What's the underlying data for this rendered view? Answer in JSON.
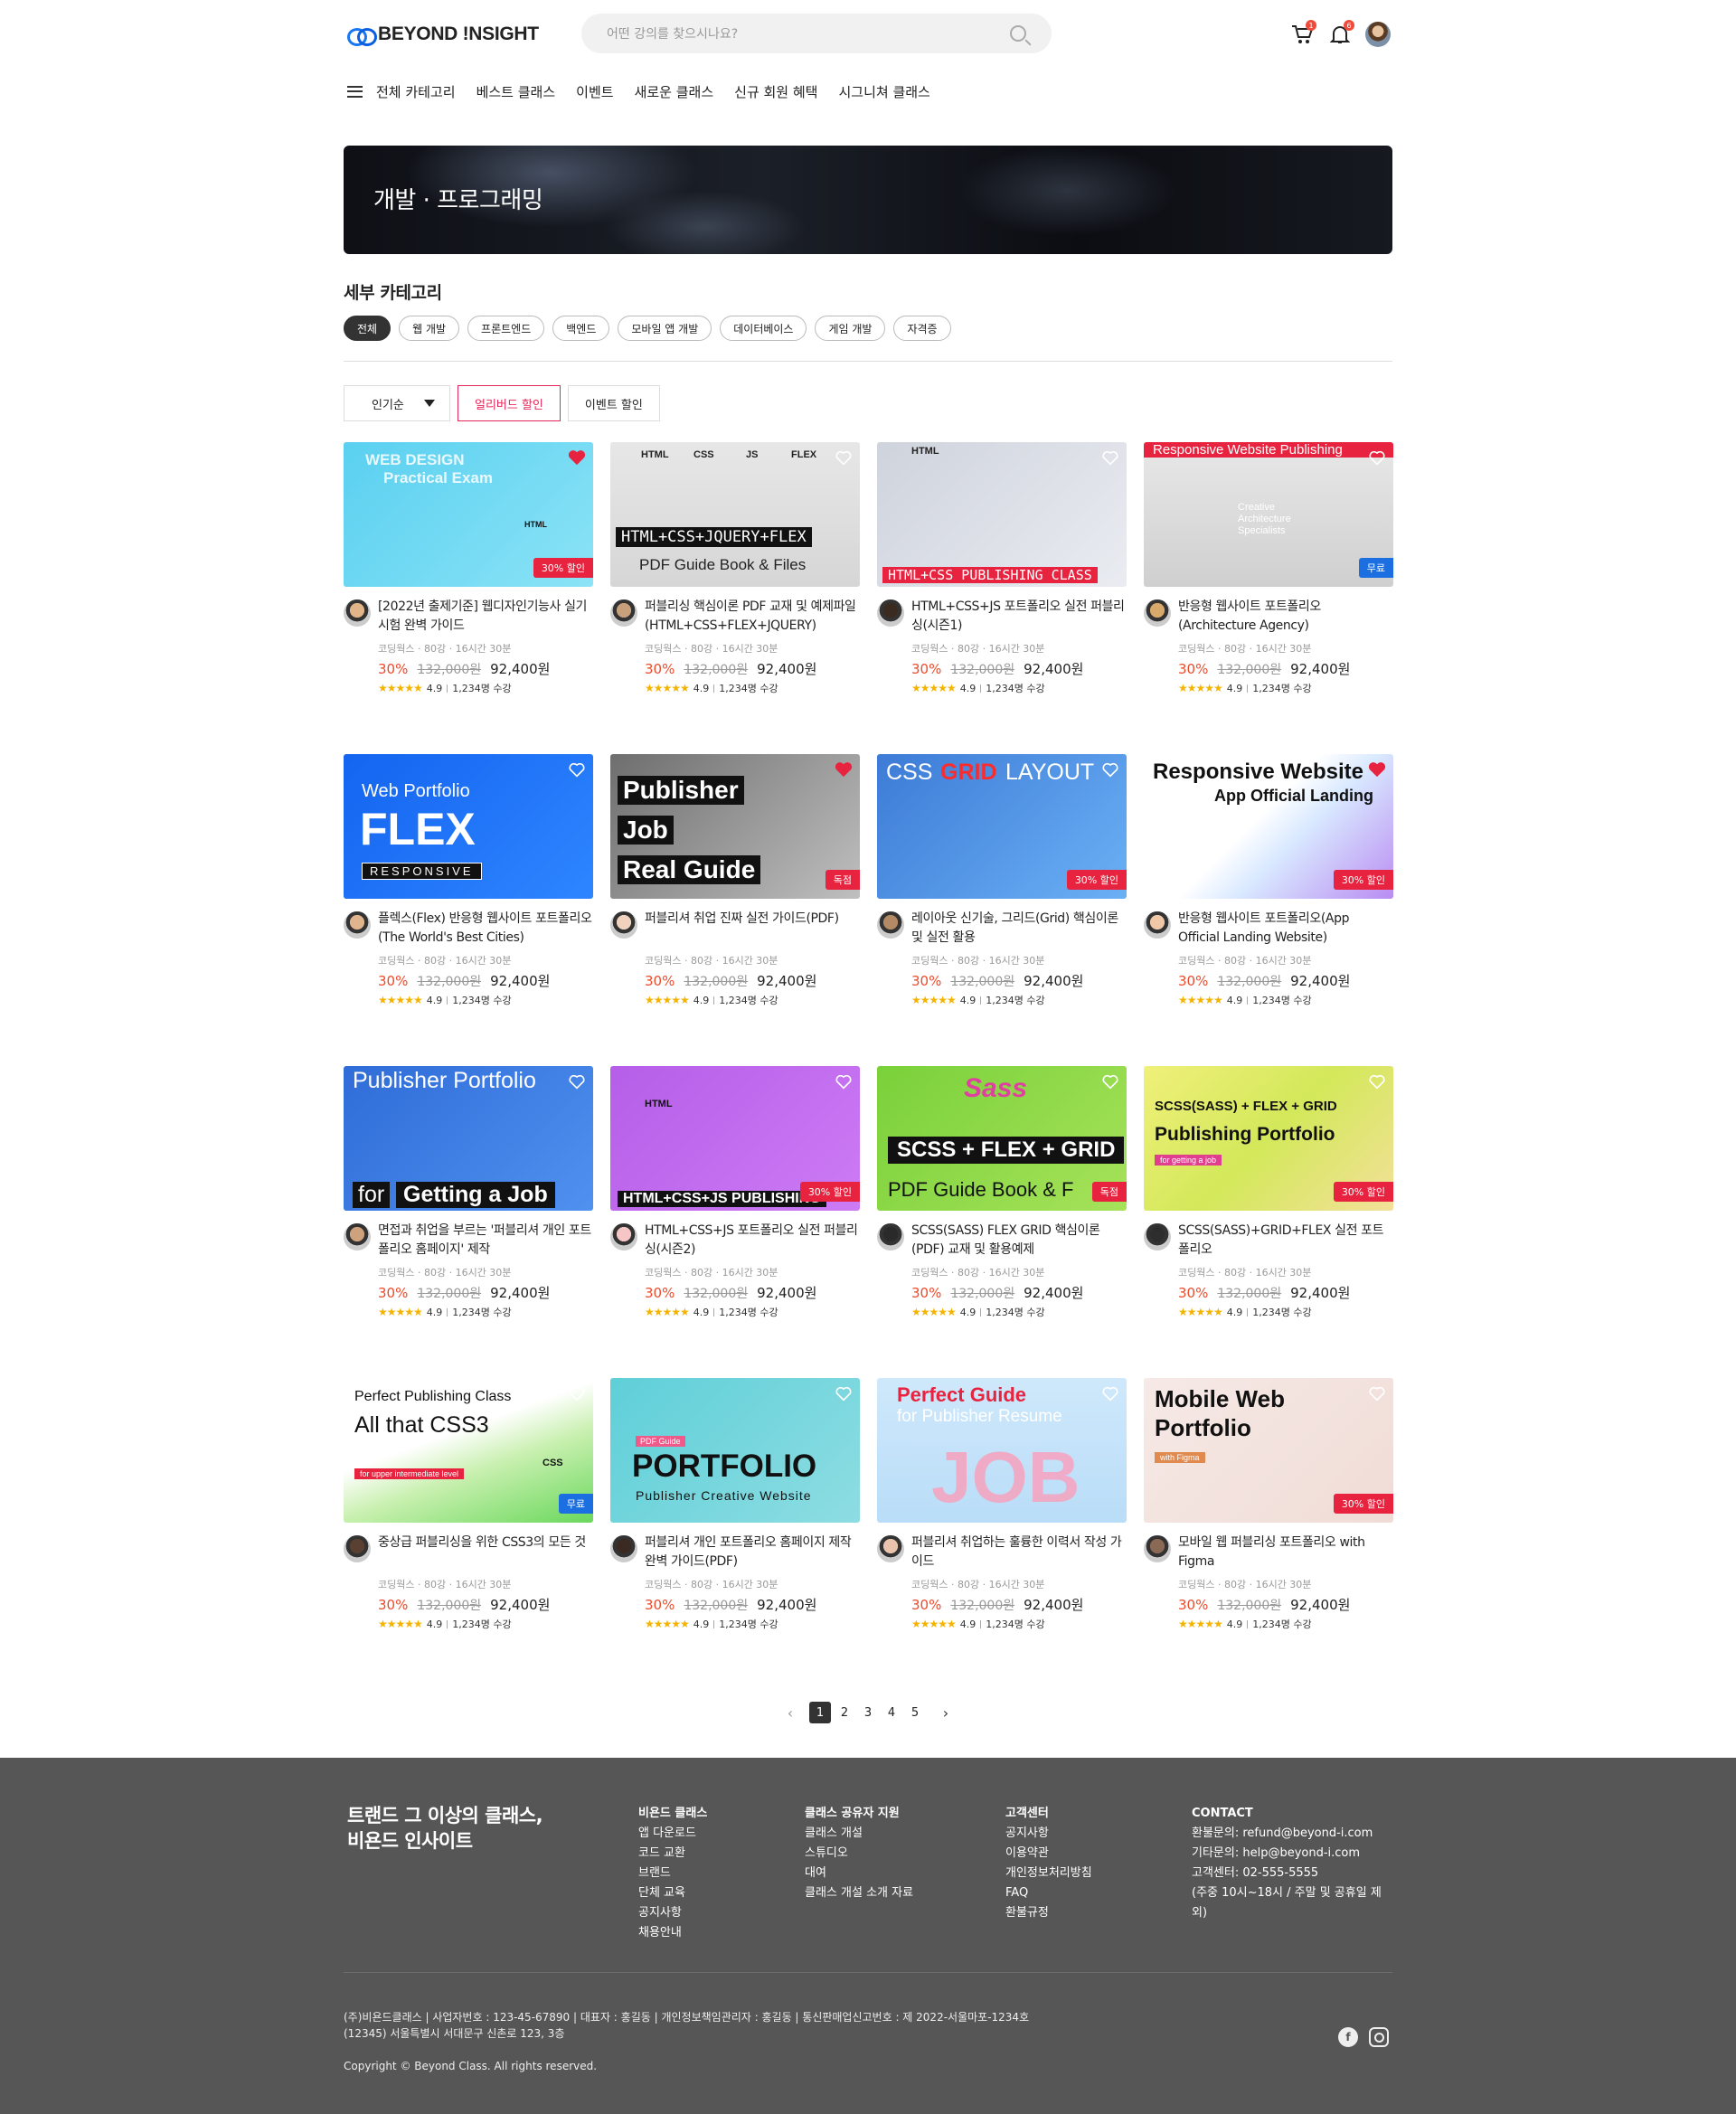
{
  "header": {
    "logo": "BEYOND !NSIGHT",
    "search_placeholder": "어떤 강의를 찾으시나요?",
    "cart_count": "1",
    "notice_count": "6"
  },
  "nav": {
    "items": [
      "전체 카테고리",
      "베스트 클래스",
      "이벤트",
      "새로운 클래스",
      "신규 회원 혜택",
      "시그니쳐 클래스"
    ]
  },
  "banner": {
    "title": "개발 · 프로그래밍"
  },
  "subcategory": {
    "title": "세부 카테고리",
    "chips": [
      "전체",
      "웹 개발",
      "프론트엔드",
      "백엔드",
      "모바일 앱 개발",
      "데이터베이스",
      "게임 개발",
      "자격증"
    ]
  },
  "filters": {
    "sort": "인기순",
    "early": "얼리버드 할인",
    "event": "이벤트 할인"
  },
  "course_common": {
    "teacher": "코딩웍스 · 80강 · 16시간 30분",
    "rate": "30%",
    "orig": "132,000원",
    "sale": "92,400원",
    "stars": "★★★★★",
    "score": "4.9",
    "students": "1,234명 수강"
  },
  "courses": [
    {
      "title": "[2022년 출제기준] 웹디자인기능사 실기시험 완벽 가이드",
      "tag": "30% 할인",
      "liked": true,
      "thumb_text": [
        "WEB DESIGN",
        "Practical Exam",
        "HTML"
      ]
    },
    {
      "title": "퍼블리싱 핵심이론 PDF 교재 및 예제파일(HTML+CSS+FLEX+JQUERY)",
      "tag": "",
      "liked": false,
      "thumb_text": [
        "HTML",
        "CSS",
        "JS",
        "FLEX",
        "HTML+CSS+JQUERY+FLEX",
        "PDF Guide Book & Files"
      ]
    },
    {
      "title": "HTML+CSS+JS 포트폴리오 실전 퍼블리싱(시즌1)",
      "tag": "",
      "liked": false,
      "thumb_text": [
        "HTML",
        "HTML+CSS PUBLISHING CLASS"
      ]
    },
    {
      "title": "반응형 웹사이트 포트폴리오(Architecture Agency)",
      "tag": "무료",
      "liked": false,
      "thumb_text": [
        "Responsive Website Publishing",
        "Creative Architecture Specialists"
      ]
    },
    {
      "title": "플렉스(Flex) 반응형 웹사이트 포트폴리오(The World's Best Cities)",
      "tag": "",
      "liked": false,
      "thumb_text": [
        "Web Portfolio",
        "FLEX",
        "RESPONSIVE"
      ]
    },
    {
      "title": "퍼블리셔 취업 진짜 실전 가이드(PDF)",
      "tag": "독점",
      "liked": true,
      "thumb_text": [
        "Publisher",
        "Job",
        "Real Guide"
      ]
    },
    {
      "title": "레이아웃 신기술, 그리드(Grid) 핵심이론 및 실전 활용",
      "tag": "30% 할인",
      "liked": false,
      "thumb_text": [
        "CSS",
        "GRID",
        "LAYOUT"
      ]
    },
    {
      "title": "반응형 웹사이트 포트폴리오(App Official Landing Website)",
      "tag": "30% 할인",
      "liked": true,
      "thumb_text": [
        "Responsive Website",
        "App Official Landing"
      ]
    },
    {
      "title": "면접과 취업을 부르는 '퍼블리셔 개인 포트폴리오 홈페이지' 제작",
      "tag": "",
      "liked": false,
      "thumb_text": [
        "Publisher Portfolio",
        "for",
        "Getting a Job"
      ]
    },
    {
      "title": "HTML+CSS+JS 포트폴리오 실전 퍼블리싱(시즌2)",
      "tag": "30% 할인",
      "liked": false,
      "thumb_text": [
        "HTML",
        "HTML+CSS+JS PUBLISHING"
      ]
    },
    {
      "title": "SCSS(SASS) FLEX GRID 핵심이론(PDF) 교재 및 활용예제",
      "tag": "독점",
      "liked": false,
      "thumb_text": [
        "Sass",
        "SCSS + FLEX + GRID",
        "PDF Guide Book & F"
      ]
    },
    {
      "title": "SCSS(SASS)+GRID+FLEX 실전 포트폴리오",
      "tag": "30% 할인",
      "liked": false,
      "thumb_text": [
        "SCSS(SASS) + FLEX + GRID",
        "Publishing Portfolio",
        "for getting a job"
      ]
    },
    {
      "title": "중상급 퍼블리싱을 위한 CSS3의 모든 것",
      "tag": "무료",
      "liked": false,
      "thumb_text": [
        "Perfect Publishing Class",
        "All that CSS3",
        "for upper intermediate level",
        "CSS"
      ]
    },
    {
      "title": "퍼블리셔 개인 포트폴리오 홈페이지 제작 완벽 가이드(PDF)",
      "tag": "",
      "liked": false,
      "thumb_text": [
        "PDF Guide",
        "PORTFOLIO",
        "Publisher Creative Website"
      ]
    },
    {
      "title": "퍼블리셔 취업하는 훌륭한 이력서 작성 가이드",
      "tag": "",
      "liked": false,
      "thumb_text": [
        "Perfect Guide",
        "for Publisher Resume",
        "JOB"
      ]
    },
    {
      "title": "모바일 웹 퍼블리싱 포트폴리오 with Figma",
      "tag": "30% 할인",
      "liked": false,
      "thumb_text": [
        "Mobile Web",
        "Portfolio",
        "with Figma"
      ]
    }
  ],
  "pagination": {
    "pages": [
      "1",
      "2",
      "3",
      "4",
      "5"
    ],
    "current": "1",
    "prev": "‹",
    "next": "›"
  },
  "footer": {
    "slogan_1": "트랜드 그 이상의  클래스,",
    "slogan_2": "비욘드 인사이트",
    "col1": {
      "title": "비욘드 클래스",
      "items": [
        "앱 다운로드",
        "코드 교환",
        "브랜드",
        "단체 교육",
        "공지사항",
        "채용안내"
      ]
    },
    "col2": {
      "title": "클래스 공유자 지원",
      "items": [
        "클래스 개설",
        "스튜디오",
        "대여",
        "클래스 개설 소개 자료"
      ]
    },
    "col3": {
      "title": "고객센터",
      "items": [
        "공지사항",
        "이용약관",
        "개인정보처리방침",
        "FAQ",
        "환불규정"
      ]
    },
    "col4": {
      "title": "CONTACT",
      "items": [
        "환불문의: refund@beyond-i.com",
        "기타문의: help@beyond-i.com",
        "고객센터: 02-555-5555",
        "(주중 10시~18시 / 주말 및 공휴일 제외)"
      ]
    },
    "info_1": "(주)비욘드클래스  |  사업자번호 : 123-45-67890  |  대표자 : 홍길동  |  개인정보책임관리자 : 홍길동  |  통신판매업신고번호 : 제 2022-서울마포-1234호",
    "info_2": "(12345) 서울특별시 서대문구 신촌로 123, 3층",
    "copyright": "Copyright © Beyond Class. All rights reserved.",
    "social": [
      "facebook-icon",
      "instagram-icon"
    ]
  },
  "colors": {
    "accent": "#e5285a",
    "discount": "#ee4b2b",
    "footer_bg": "#565656",
    "free_tag": "#1b6fe0"
  }
}
